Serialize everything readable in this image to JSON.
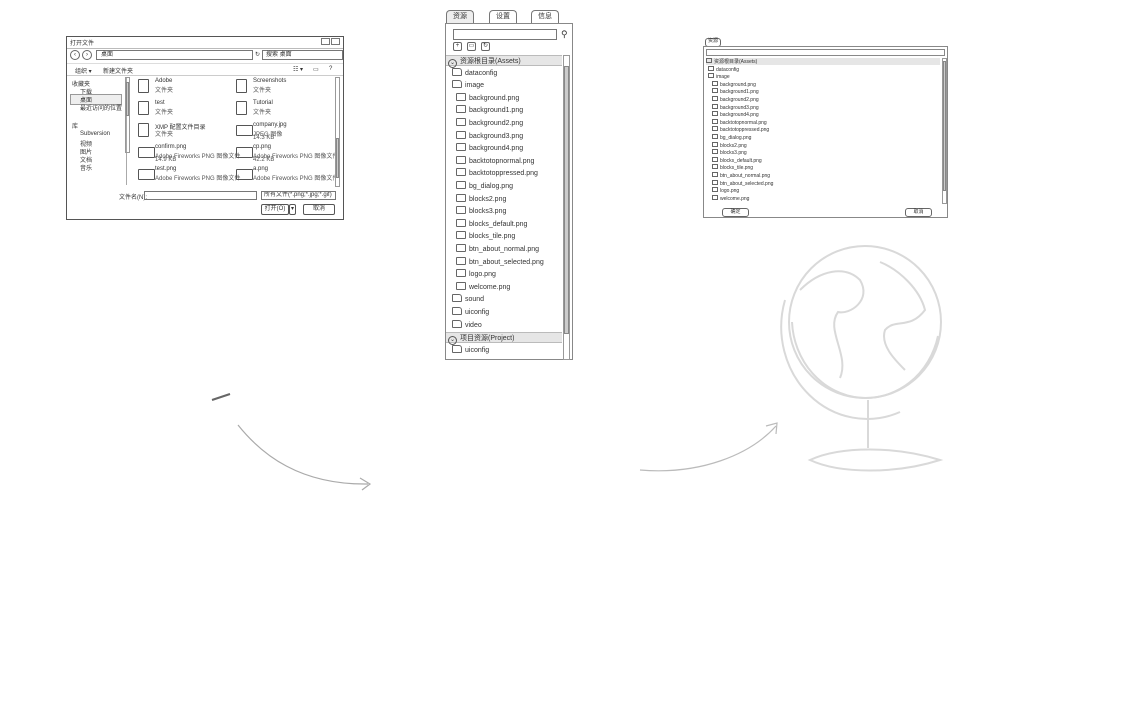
{
  "dialog": {
    "title": "打开文件",
    "address": "桌面",
    "search_placeholder": "搜索 桌面",
    "toolbar": {
      "organize": "组织 ▾",
      "new_folder": "新建文件夹"
    },
    "nav": [
      {
        "label": "收藏夹",
        "kind": "header"
      },
      {
        "label": "下载"
      },
      {
        "label": "桌面",
        "selected": true
      },
      {
        "label": "最近访问的位置"
      },
      {
        "label": "库",
        "kind": "header"
      },
      {
        "label": "Subversion"
      },
      {
        "label": "视频"
      },
      {
        "label": "图片"
      },
      {
        "label": "文档"
      },
      {
        "label": "音乐"
      }
    ],
    "files": [
      {
        "name": "Adobe",
        "type": "文件夹",
        "icon": "folder-icon"
      },
      {
        "name": "Screenshots",
        "type": "文件夹",
        "icon": "folder-icon"
      },
      {
        "name": "test",
        "type": "文件夹",
        "icon": "folder-icon"
      },
      {
        "name": "Tutorial",
        "type": "文件夹",
        "icon": "folder-icon"
      },
      {
        "name": "XMP 配置文件目录",
        "type": "文件夹",
        "icon": "folder-icon"
      },
      {
        "name": "company.jpg",
        "type": "JPEG 图像",
        "size": "14.3 KB",
        "icon": "image-icon"
      },
      {
        "name": "confirm.png",
        "type": "Adobe Fireworks PNG 图像文件",
        "size": "14.9 KB",
        "icon": "image-icon"
      },
      {
        "name": "cp.png",
        "type": "Adobe Fireworks PNG 图像文件",
        "size": "42.2 KB",
        "icon": "image-icon"
      },
      {
        "name": "test.png",
        "type": "Adobe Fireworks PNG 图像文件",
        "size": "",
        "icon": "image-icon"
      },
      {
        "name": "a.png",
        "type": "Adobe Fireworks PNG 图像文件",
        "size": "",
        "icon": "image-icon"
      }
    ],
    "filename_label": "文件名(N):",
    "filetype": "所有文件(*.png;*.jpg;*.gif)",
    "open_button": "打开(O)",
    "cancel_button": "取消"
  },
  "sidebar": {
    "tabs": [
      "资源",
      "设置",
      "信息"
    ],
    "rows": [
      {
        "label": "资源根目录(Assets)",
        "kind": "header"
      },
      {
        "label": "dataconfig",
        "kind": "folder",
        "indent": 1
      },
      {
        "label": "image",
        "kind": "folder",
        "indent": 1
      },
      {
        "label": "background.png",
        "kind": "image",
        "indent": 2
      },
      {
        "label": "background1.png",
        "kind": "image",
        "indent": 2
      },
      {
        "label": "background2.png",
        "kind": "image",
        "indent": 2
      },
      {
        "label": "background3.png",
        "kind": "image",
        "indent": 2
      },
      {
        "label": "background4.png",
        "kind": "image",
        "indent": 2
      },
      {
        "label": "backtotopnormal.png",
        "kind": "image",
        "indent": 2
      },
      {
        "label": "backtotoppressed.png",
        "kind": "image",
        "indent": 2
      },
      {
        "label": "bg_dialog.png",
        "kind": "image",
        "indent": 2
      },
      {
        "label": "blocks2.png",
        "kind": "image",
        "indent": 2
      },
      {
        "label": "blocks3.png",
        "kind": "image",
        "indent": 2
      },
      {
        "label": "blocks_default.png",
        "kind": "image",
        "indent": 2
      },
      {
        "label": "blocks_tile.png",
        "kind": "image",
        "indent": 2
      },
      {
        "label": "btn_about_normal.png",
        "kind": "image",
        "indent": 2
      },
      {
        "label": "btn_about_selected.png",
        "kind": "image",
        "indent": 2
      },
      {
        "label": "logo.png",
        "kind": "image",
        "indent": 2
      },
      {
        "label": "welcome.png",
        "kind": "image",
        "indent": 2
      },
      {
        "label": "sound",
        "kind": "folder",
        "indent": 1
      },
      {
        "label": "uiconfig",
        "kind": "folder",
        "indent": 1
      },
      {
        "label": "video",
        "kind": "folder",
        "indent": 1
      },
      {
        "label": "项目资源(Project)",
        "kind": "header"
      },
      {
        "label": "uiconfig",
        "kind": "folder",
        "indent": 1
      }
    ]
  },
  "mini": {
    "tag": "资源",
    "rows": [
      {
        "label": "资源根目录(Assets)",
        "kind": "header"
      },
      {
        "label": "dataconfig",
        "indent": 1
      },
      {
        "label": "image",
        "indent": 1
      },
      {
        "label": "background.png",
        "indent": 2
      },
      {
        "label": "background1.png",
        "indent": 2
      },
      {
        "label": "background2.png",
        "indent": 2
      },
      {
        "label": "background3.png",
        "indent": 2
      },
      {
        "label": "background4.png",
        "indent": 2
      },
      {
        "label": "backtotopnormal.png",
        "indent": 2
      },
      {
        "label": "backtotoppressed.png",
        "indent": 2
      },
      {
        "label": "bg_dialog.png",
        "indent": 2
      },
      {
        "label": "blocks2.png",
        "indent": 2
      },
      {
        "label": "blocks3.png",
        "indent": 2
      },
      {
        "label": "blocks_default.png",
        "indent": 2
      },
      {
        "label": "blocks_tile.png",
        "indent": 2
      },
      {
        "label": "btn_about_normal.png",
        "indent": 2
      },
      {
        "label": "btn_about_selected.png",
        "indent": 2
      },
      {
        "label": "logo.png",
        "indent": 2
      },
      {
        "label": "welcome.png",
        "indent": 2
      }
    ],
    "confirm_button": "确定",
    "cancel_button": "取消"
  }
}
